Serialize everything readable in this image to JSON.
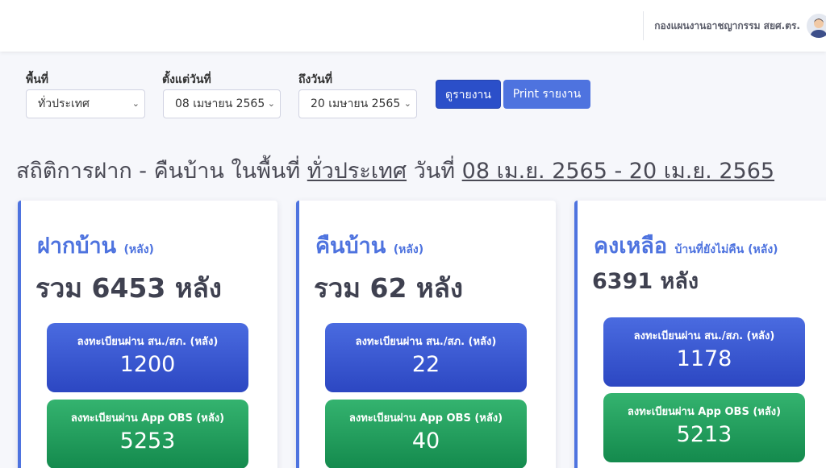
{
  "header": {
    "user_name": "กองแผนงานอาชญากรรม สยศ.ตร.",
    "avatar_icon": "user-avatar-icon"
  },
  "filters": {
    "area_label": "พื้นที่",
    "area_value": "ทั่วประเทศ",
    "from_label": "ตั้งแต่วันที่",
    "from_value": "08 เมษายน 2565",
    "to_label": "ถึงวันที่",
    "to_value": "20 เมษายน 2565",
    "view_report_button": "ดูรายงาน",
    "print_report_button": "Print รายงาน"
  },
  "headline": {
    "prefix": "สถิติการฝาก - คืนบ้าน ในพื้นที่",
    "area": "ทั่วประเทศ",
    "date_prefix": " วันที่",
    "date_range": "08 เม.ย. 2565 - 20 เม.ย. 2565"
  },
  "cards": [
    {
      "title": "ฝากบ้าน",
      "unit": "(หลัง)",
      "total": "รวม 6453 หลัง",
      "police_label": "ลงทะเบียนผ่าน สน./สภ. (หลัง)",
      "police_value": "1200",
      "app_label": "ลงทะเบียนผ่าน App OBS (หลัง)",
      "app_value": "5253"
    },
    {
      "title": "คืนบ้าน",
      "unit": "(หลัง)",
      "total": "รวม 62 หลัง",
      "police_label": "ลงทะเบียนผ่าน สน./สภ. (หลัง)",
      "police_value": "22",
      "app_label": "ลงทะเบียนผ่าน App OBS (หลัง)",
      "app_value": "40"
    },
    {
      "title": "คงเหลือ",
      "unit": "บ้านที่ยังไม่คืน (หลัง)",
      "total": "6391 หลัง",
      "police_label": "ลงทะเบียนผ่าน สน./สภ. (หลัง)",
      "police_value": "1178",
      "app_label": "ลงทะเบียนผ่าน App OBS (หลัง)",
      "app_value": "5213"
    }
  ],
  "colors": {
    "primary": "#4e73df",
    "button_dark": "#2b4fc9",
    "stat_blue": "#2c47c2",
    "stat_green": "#148a4d"
  }
}
